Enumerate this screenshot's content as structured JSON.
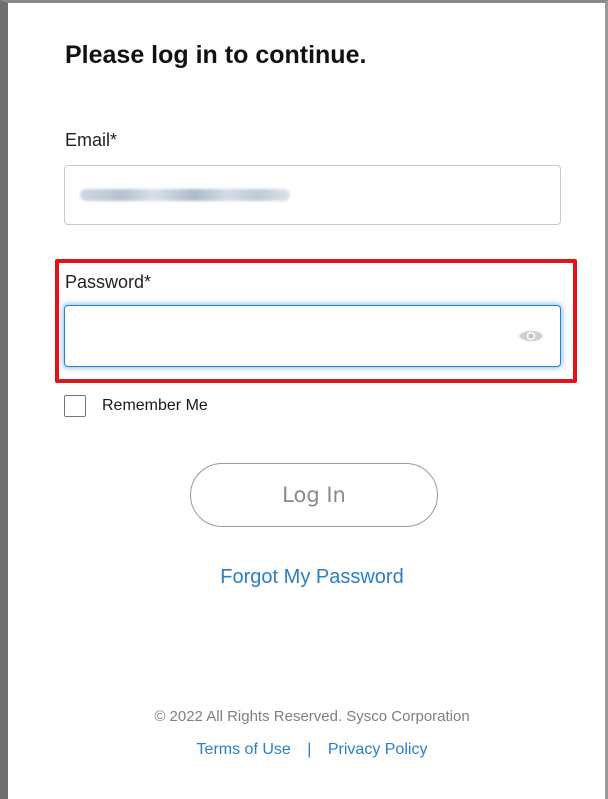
{
  "form": {
    "title": "Please log in to continue.",
    "email_label": "Email*",
    "email_value": "hello.bonk@gmail.com",
    "password_label": "Password*",
    "password_value": "",
    "remember_label": "Remember Me",
    "remember_checked": false,
    "login_label": "Log In",
    "forgot_label": "Forgot My Password",
    "eye_icon": "eye-icon"
  },
  "footer": {
    "copyright": "© 2022 All Rights Reserved. Sysco Corporation",
    "terms_label": "Terms of Use",
    "separator": "|",
    "privacy_label": "Privacy Policy"
  },
  "colors": {
    "accent": "#2a7fc9",
    "focus_border": "#2b84c9",
    "highlight": "#e0151b"
  }
}
